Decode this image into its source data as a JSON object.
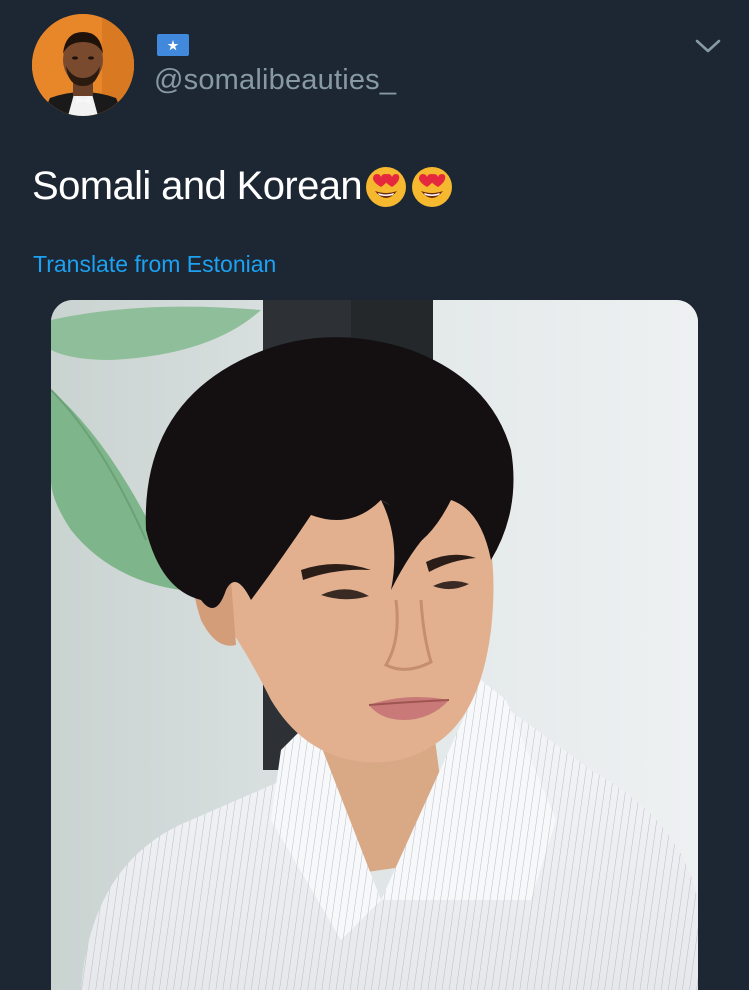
{
  "tweet": {
    "handle": "@somalibeauties_",
    "flag_icon": "somalia-flag-icon",
    "text": "Somali and Korean",
    "emojis": [
      "heart-eyes-emoji",
      "heart-eyes-emoji"
    ],
    "translate_label": "Translate from Estonian",
    "menu_icon": "chevron-down-icon"
  },
  "colors": {
    "background": "#1c2733",
    "text": "#ffffff",
    "secondary": "#8899a6",
    "link": "#1da1f2",
    "flag_blue": "#4189dd"
  }
}
